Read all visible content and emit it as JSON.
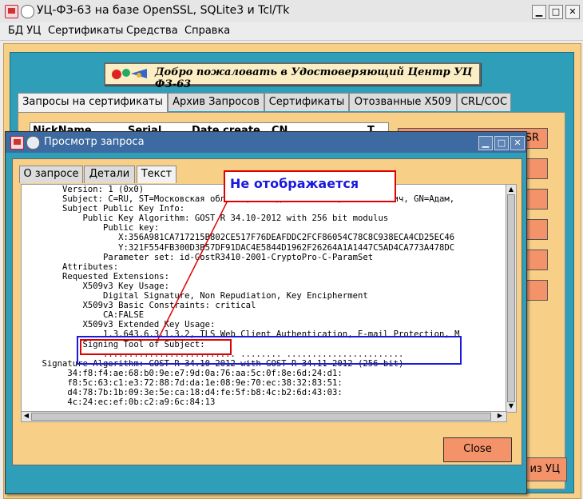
{
  "window": {
    "title": "УЦ-ФЗ-63 на базе OpenSSL, SQLite3 и Tcl/Tk"
  },
  "menu": [
    "БД УЦ",
    "Сертификаты",
    "Средства",
    "Справка"
  ],
  "banner": {
    "text": "Добро пожаловать в Удостоверяющий Центр УЦ ФЗ-63"
  },
  "main_tabs": [
    "Запросы на сертификаты",
    "Архив Запросов",
    "Сертификаты",
    "Отозванные X509",
    "CRL/COC"
  ],
  "table_headers": [
    "NickName",
    "Serial",
    "Date create",
    "CN",
    "T"
  ],
  "side_buttons": {
    "b1": "SR",
    "b7": "и из УЦ"
  },
  "dialog": {
    "title": "Просмотр запроса",
    "tabs": [
      "О запросе",
      "Детали",
      "Текст"
    ],
    "text_lines": [
      "        Version: 1 (0x0)",
      "        Subject: C=RU, ST=Московская область, CN=Адам Козлевич, SN=Козлевич, GN=Адам,",
      "        Subject Public Key Info:",
      "            Public Key Algorithm: GOST R 34.10-2012 with 256 bit modulus",
      "                Public key:",
      "                   X:356A981CA717215B802CE517F76DEAFDDC2FCF86054C78C8C938ECA4CD25EC46",
      "                   Y:321F554FB300D3B57DF91DAC4E5844D1962F26264A1A1447C5AD4CA773A478DC",
      "                Parameter set: id-GostR3410-2001-CryptoPro-C-ParamSet",
      "        Attributes:",
      "        Requested Extensions:",
      "            X509v3 Key Usage:",
      "                Digital Signature, Non Repudiation, Key Encipherment",
      "            X509v3 Basic Constraints: critical",
      "                CA:FALSE",
      "            X509v3 Extended Key Usage:",
      "                1.3.643.6.3.1.3.2, TLS Web Client Authentication, E-mail Protection, M",
      "            Signing Tool of Subject:",
      "                .......................... ........ .......................",
      "    Signature Algorithm: GOST R 34.10-2012 with GOST R 34.11-2012 (256 bit)",
      "         34:f8:f4:ae:68:b0:9e:e7:9d:0a:76:aa:5c:0f:8e:6d:24:d1:",
      "         f8:5c:63:c1:e3:72:88:7d:da:1e:08:9e:70:ec:38:32:83:51:",
      "         d4:78:7b:1b:09:3e:5e:ca:18:d4:fe:5f:b8:4c:b2:6d:43:03:",
      "         4c:24:ec:ef:0b:c2:a9:6c:84:13"
    ],
    "close_label": "Close"
  },
  "annotation": {
    "text": "Не отображается",
    "color_red": "#e00000",
    "color_blue": "#1a1adc"
  },
  "colors": {
    "teal": "#2f9fb9",
    "orange": "#f4936a",
    "tan": "#f7cf86",
    "dialog_title": "#3d6aa0"
  }
}
